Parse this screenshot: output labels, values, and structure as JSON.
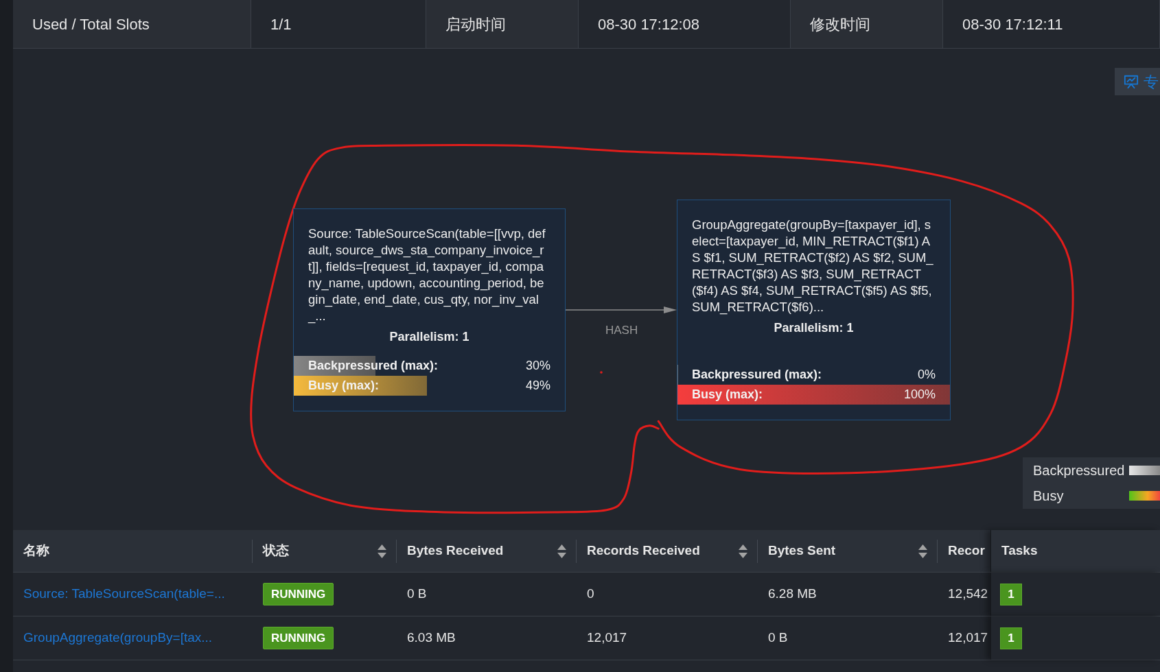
{
  "summary": [
    {
      "label": "Used / Total Slots",
      "value": "1/1"
    },
    {
      "label": "启动时间",
      "value": "08-30 17:12:08"
    },
    {
      "label": "修改时间",
      "value": "08-30 17:12:11"
    }
  ],
  "toolbar_button": {
    "label": "专"
  },
  "graph": {
    "nodes": [
      {
        "description": "Source: TableSourceScan(table=[[vvp, default, source_dws_sta_company_invoice_rt]], fields=[request_id, taxpayer_id, company_name, updown, accounting_period, begin_date, end_date, cus_qty, nor_inv_val_...",
        "parallelism": "Parallelism: 1",
        "metrics": [
          {
            "kind": "backpressured",
            "label": "Backpressured (max):",
            "reading": "30%",
            "level": 0.3
          },
          {
            "kind": "busy",
            "label": "Busy (max):",
            "reading": "49%",
            "level": 0.49
          }
        ]
      },
      {
        "description": "GroupAggregate(groupBy=[taxpayer_id], select=[taxpayer_id, MIN_RETRACT($f1) AS $f1, SUM_RETRACT($f2) AS $f2, SUM_RETRACT($f3) AS $f3, SUM_RETRACT($f4) AS $f4, SUM_RETRACT($f5) AS $f5, SUM_RETRACT($f6)...",
        "parallelism": "Parallelism: 1",
        "metrics": [
          {
            "kind": "backpressured",
            "label": "Backpressured (max):",
            "reading": "0%",
            "level": 0
          },
          {
            "kind": "busy",
            "label": "Busy (max):",
            "reading": "100%",
            "level": 1
          }
        ]
      }
    ],
    "edges": [
      {
        "label": "HASH"
      }
    ]
  },
  "legend": [
    {
      "kind": "backpressured",
      "label": "Backpressured"
    },
    {
      "kind": "busy",
      "label": "Busy"
    }
  ],
  "table": {
    "columns": [
      {
        "label": "名称",
        "sortable": false
      },
      {
        "label": "状态",
        "sortable": true
      },
      {
        "label": "Bytes Received",
        "sortable": true
      },
      {
        "label": "Records Received",
        "sortable": true
      },
      {
        "label": "Bytes Sent",
        "sortable": true
      },
      {
        "label": "Recor",
        "sortable": false
      },
      {
        "label": "Tasks",
        "sortable": false
      }
    ],
    "rows": [
      {
        "cells": [
          {
            "kind": "link",
            "text": "Source: TableSourceScan(table=..."
          },
          {
            "kind": "status",
            "text": "RUNNING"
          },
          {
            "kind": "text",
            "text": "0 B"
          },
          {
            "kind": "text",
            "text": "0"
          },
          {
            "kind": "text",
            "text": "6.28 MB"
          },
          {
            "kind": "text",
            "text": "12,542"
          },
          {
            "kind": "count",
            "text": "1"
          }
        ]
      },
      {
        "cells": [
          {
            "kind": "link",
            "text": "GroupAggregate(groupBy=[tax..."
          },
          {
            "kind": "status",
            "text": "RUNNING"
          },
          {
            "kind": "text",
            "text": "6.03 MB"
          },
          {
            "kind": "text",
            "text": "12,017"
          },
          {
            "kind": "text",
            "text": "0 B"
          },
          {
            "kind": "text",
            "text": "12,017"
          },
          {
            "kind": "count",
            "text": "1"
          }
        ]
      }
    ]
  }
}
